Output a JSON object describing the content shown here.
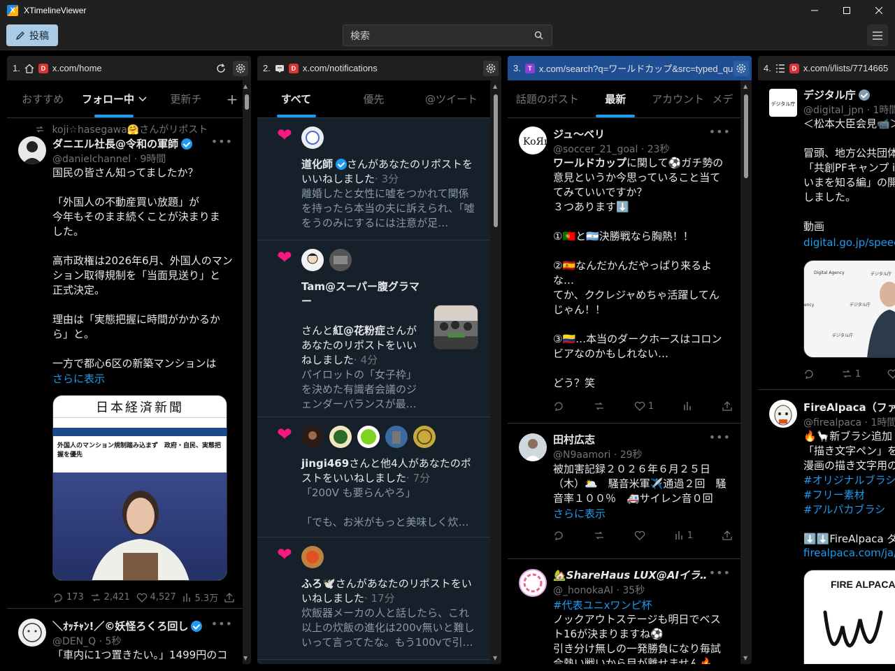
{
  "window": {
    "title": "XTimelineViewer"
  },
  "toolbar": {
    "post_label": "投稿",
    "search_placeholder": "検索"
  },
  "columns": [
    {
      "num": "1.",
      "url": "x.com/home",
      "tabs": [
        "おすすめ",
        "フォロー中",
        "更新チ"
      ],
      "tweets": [
        {
          "repost_by": "koji☆hasegawa🤗さんがリポスト",
          "name": "ダニエル社長@令和の軍師",
          "handle": "@danielchannel · 9時間",
          "text": "国民の皆さん知ってましたか？\n\n「外国人の不動産買い放題」が\n今年もそのまま続くことが決まりま\nした。\n\n高市政権は2026年6月、外国人のマン\nション取得規制を「当面見送り」と\n正式決定。\n\n理由は「実態把握に時間がかかるか\nら」と。\n\n一方で都心6区の新築マンションは",
          "show_more": "さらに表示",
          "media": {
            "masthead": "日本経済新聞",
            "headline": "外国人のマンション規制踏み込まず　政府・自民、実態把握を優先"
          },
          "stats": {
            "replies": "173",
            "reposts": "2,421",
            "likes": "4,527",
            "views": "5.3万"
          }
        },
        {
          "name": "＼ｵｯﾁｬﾝ!／©妖怪ろくろ回し",
          "handle": "@DEN_Q · 5秒",
          "text": "「車内に1つ置きたい。」1499円のコ"
        }
      ]
    },
    {
      "num": "2.",
      "url": "x.com/notifications",
      "tabs": [
        "すべて",
        "優先",
        "@ツイート"
      ],
      "notifications": [
        {
          "actor": "道化師",
          "rest": "さんがあなたのリポストをいいねしました",
          "time": "· 3分",
          "preview": "離婚したと女性に嘘をつかれて関係を持ったら本当の夫に訴えられ、「嘘をうのみにするには注意が足…"
        },
        {
          "actor": "Tam@スーパー腹グラマー",
          "mid": "さんと",
          "actor2": "紅@花粉症",
          "rest": "さんがあなたのリポストをいいねしました",
          "time": "· 4分",
          "preview": "パイロットの「女子枠」を決めた有識者会議のジェンダーバランスが最…"
        },
        {
          "actor": "jingi469",
          "rest": "さんと他4人があなたのポストをいいねしました",
          "time": "· 7分",
          "preview": "「200V も要らんやろ」\n\n「でも、お米がもっと美味しく炊…"
        },
        {
          "actor": "ふろ🕊️",
          "rest": "さんがあなたのリポストをいいねしました",
          "time": "· 17分",
          "preview": "炊飯器メーカの人と話したら、これ以上の炊飯の進化は200v無いと難しいって言ってたな。もう100vで引…"
        }
      ]
    },
    {
      "num": "3.",
      "url": "x.com/search?q=ワールドカップ&src=typed_qu",
      "tabs": [
        "話題のポスト",
        "最新",
        "アカウント",
        "メデ"
      ],
      "tweets": [
        {
          "name": "ジュ〜ベリ",
          "handle": "@soccer_21_goal · 23秒",
          "text_bold": "ワールドカップ",
          "text": "に関して⚽ガチ勢の\n意見というか今思っていること当て\nてみていいですか？\n３つあります⬇️\n\n①🇵🇹と🇦🇷決勝戦なら胸熱！！\n\n②🇪🇸なんだかんだやっぱり来るよ\nな…\nてか、ククレジャめちゃ活躍してん\nじゃん！！\n\n③🇨🇴…本当のダークホースはコロン\nビアなのかもしれない…\n\nどう？笑",
          "stats": {
            "likes": "1"
          }
        },
        {
          "name": "田村広志",
          "handle": "@N9aamori · 29秒",
          "text": "被加害記録２０２６年６月２５日\n（木）🌥️　騒音米軍✈️通過２回　騒\n音率１００％　🚑サイレン音０回",
          "show_more": "さらに表示",
          "stats": {
            "views": "1"
          }
        },
        {
          "name": "🏡ShareHaus LUX@AIイラ…",
          "handle": "@_honokaAI · 35秒",
          "hashtag": "#代表ユニxワンピ杯",
          "text": "ノックアウトステージも明日でベス\nト16が決まりますね⚽\n引き分け無しの一発勝負になり毎試\n合熱い戦いから目が離せません🔥"
        }
      ]
    },
    {
      "num": "4.",
      "url": "x.com/i/lists/7714665",
      "tweets": [
        {
          "name": "デジタル庁",
          "handle": "@digital_jpn · 1時間",
          "text": "＜松本大臣会見📹＞\n\n冒頭、地方公共団体\n「共創PFキャンプ i\nいまを知る編」の開\nしました。\n\n動画",
          "link": "digital.go.jp/speech",
          "media_labels": [
            "Digital Agency",
            "デジタル庁",
            "デジタル庁",
            "デジタル庁",
            "ency"
          ],
          "stats": {
            "reposts": "1"
          }
        },
        {
          "name": "FireAlpaca（ファイ",
          "handle": "@firealpaca · 1時間",
          "text": "🔥🦙新ブラシ追加\n「描き文字ペン」を\n漫画の描き文字用の",
          "hashtags": [
            "#オリジナルブラシ",
            "#フリー素材",
            "#アルパカブラシ"
          ],
          "text2": "⬇️⬇️FireAlpaca ダ",
          "link": "firealpaca.com/ja/",
          "media_logo": "FIRE ALPACA"
        }
      ]
    }
  ]
}
